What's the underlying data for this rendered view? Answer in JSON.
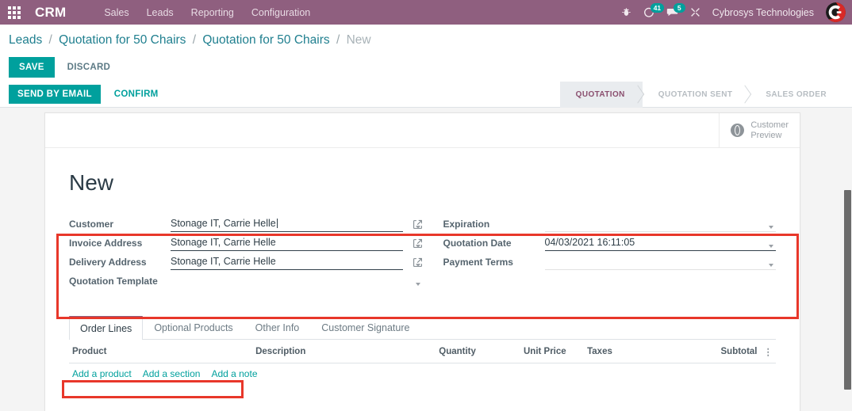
{
  "navbar": {
    "apps_icon": "apps-grid-icon",
    "brand": "CRM",
    "menus": [
      {
        "label": "Sales"
      },
      {
        "label": "Leads"
      },
      {
        "label": "Reporting"
      },
      {
        "label": "Configuration"
      }
    ],
    "icons": [
      {
        "name": "bug-icon",
        "glyph": "☣",
        "badge": ""
      },
      {
        "name": "activity-clock-icon",
        "glyph": "◔",
        "badge": "41"
      },
      {
        "name": "messages-icon",
        "glyph": "●",
        "badge": "5"
      },
      {
        "name": "tools-icon",
        "glyph": "✖",
        "badge": ""
      }
    ],
    "user_name": "Cybrosys Technologies",
    "avatar_alt": "user-avatar"
  },
  "breadcrumb": {
    "items": [
      {
        "label": "Leads",
        "active": false
      },
      {
        "label": "Quotation for 50 Chairs",
        "active": false
      },
      {
        "label": "Quotation for 50 Chairs",
        "active": false
      },
      {
        "label": "New",
        "active": true
      }
    ],
    "separator": "/"
  },
  "control_panel": {
    "save_label": "SAVE",
    "discard_label": "DISCARD"
  },
  "statusbar": {
    "send_by_email_label": "SEND BY EMAIL",
    "confirm_label": "CONFIRM",
    "stages": [
      {
        "label": "QUOTATION",
        "active": true
      },
      {
        "label": "QUOTATION SENT",
        "active": false
      },
      {
        "label": "SALES ORDER",
        "active": false
      }
    ]
  },
  "sheet": {
    "customer_preview_label_line1": "Customer",
    "customer_preview_label_line2": "Preview",
    "record_title": "New",
    "fields_left": [
      {
        "label": "Customer",
        "value": "Stonage IT, Carrie Helle",
        "placeholder": "",
        "has_caret": true,
        "has_ext_link": true,
        "focused": true,
        "filled": true
      },
      {
        "label": "Invoice Address",
        "value": "Stonage IT, Carrie Helle",
        "placeholder": "",
        "has_caret": true,
        "has_ext_link": true,
        "focused": false,
        "filled": true
      },
      {
        "label": "Delivery Address",
        "value": "Stonage IT, Carrie Helle",
        "placeholder": "",
        "has_caret": true,
        "has_ext_link": true,
        "focused": false,
        "filled": true
      },
      {
        "label": "Quotation Template",
        "value": "",
        "placeholder": "",
        "has_caret": true,
        "has_ext_link": false,
        "focused": false,
        "filled": false
      }
    ],
    "fields_right": [
      {
        "label": "Expiration",
        "value": "",
        "placeholder": "",
        "has_caret": true,
        "has_ext_link": false,
        "focused": false,
        "filled": false
      },
      {
        "label": "Quotation Date",
        "value": "04/03/2021 16:11:05",
        "placeholder": "",
        "has_caret": true,
        "has_ext_link": false,
        "focused": false,
        "filled": true
      },
      {
        "label": "Payment Terms",
        "value": "",
        "placeholder": "",
        "has_caret": true,
        "has_ext_link": false,
        "focused": false,
        "filled": false
      }
    ],
    "tabs": [
      {
        "label": "Order Lines",
        "active": true
      },
      {
        "label": "Optional Products",
        "active": false
      },
      {
        "label": "Other Info",
        "active": false
      },
      {
        "label": "Customer Signature",
        "active": false
      }
    ],
    "order_lines": {
      "columns": [
        {
          "label": "Product",
          "align": "left"
        },
        {
          "label": "Description",
          "align": "left"
        },
        {
          "label": "Quantity",
          "align": "left"
        },
        {
          "label": "Unit Price",
          "align": "left"
        },
        {
          "label": "Taxes",
          "align": "left"
        },
        {
          "label": "Subtotal",
          "align": "right"
        }
      ],
      "optional_columns_icon": "⋮",
      "rows": [],
      "add_links": [
        {
          "label": "Add a product"
        },
        {
          "label": "Add a section"
        },
        {
          "label": "Add a note"
        }
      ]
    }
  },
  "annotations": [
    {
      "name": "fields-highlight",
      "color": "#e8372a"
    },
    {
      "name": "add-links-highlight",
      "color": "#e8372a"
    }
  ],
  "colors": {
    "navbar_purple": "#8f5f7f",
    "accent_teal": "#00a09d",
    "annotation_red": "#e8372a",
    "active_stage": "#8a4e6e"
  }
}
